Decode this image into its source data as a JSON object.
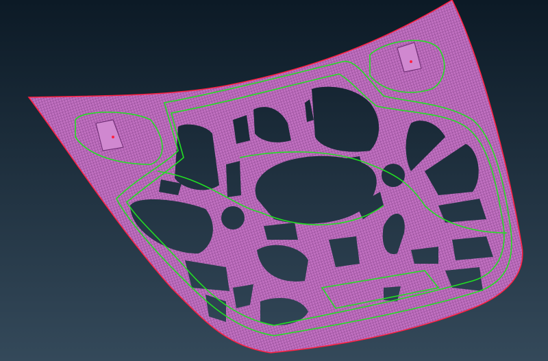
{
  "viewport": {
    "background_top": "#0c1a26",
    "background_bottom": "#34495a",
    "mesh_color": "#c070c0",
    "mesh_line_color": "#6a2a70",
    "feature_line_color": "#22e022",
    "free_edge_color": "#ff2040"
  }
}
